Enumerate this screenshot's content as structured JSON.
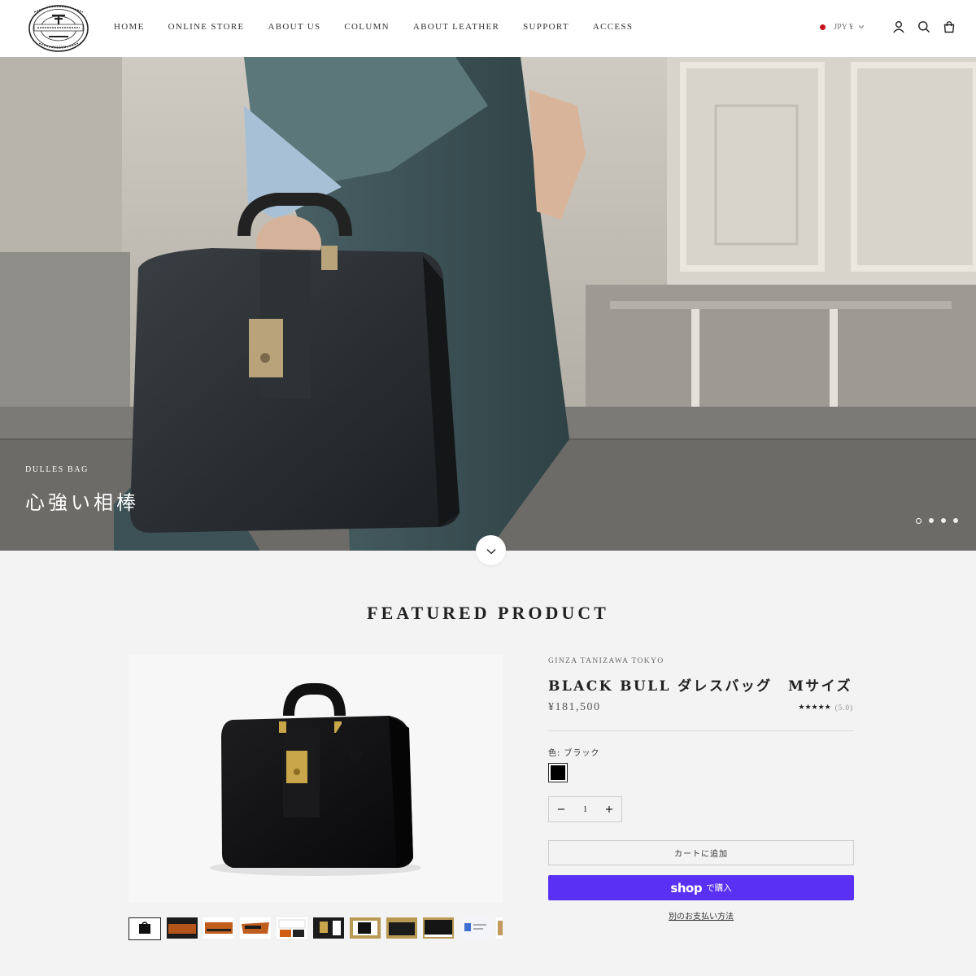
{
  "brand": {
    "logo_text": [
      "MANUFACTURES OF",
      "TRADE MARK",
      "NATIONAL GOLD & SILVER MEDALS",
      "TANIZAWA",
      "TRUNKS & BAGS",
      "GINZA TOKYO"
    ]
  },
  "nav": {
    "items": [
      "HOME",
      "ONLINE STORE",
      "ABOUT US",
      "COLUMN",
      "ABOUT LEATHER",
      "SUPPORT",
      "ACCESS"
    ]
  },
  "header_right": {
    "currency": "JPY ¥",
    "icons": [
      "account-icon",
      "search-icon",
      "cart-icon"
    ]
  },
  "hero": {
    "eyebrow": "DULLES BAG",
    "title": "心強い相棒",
    "slide_count": 4,
    "active_slide": 1
  },
  "featured": {
    "section_title": "FEATURED PRODUCT",
    "vendor": "GINZA TANIZAWA TOKYO",
    "product_title": "BLACK BULL ダレスバッグ　Mサイズ",
    "price": "¥181,500",
    "stars": "★★★★★",
    "rating": "(5.0)",
    "color_label": "色:",
    "color_value": "ブラック",
    "swatch_color": "#000000",
    "quantity": "1",
    "add_to_cart": "カートに追加",
    "shop_pay_logo": "shop",
    "shop_pay_suffix": "で購入",
    "other_payment": "別のお支払い方法",
    "thumbnail_count": 11
  },
  "colors": {
    "shop_pay": "#5a31f4",
    "background": "#f3f3f3",
    "flag_red": "#c4121f"
  }
}
